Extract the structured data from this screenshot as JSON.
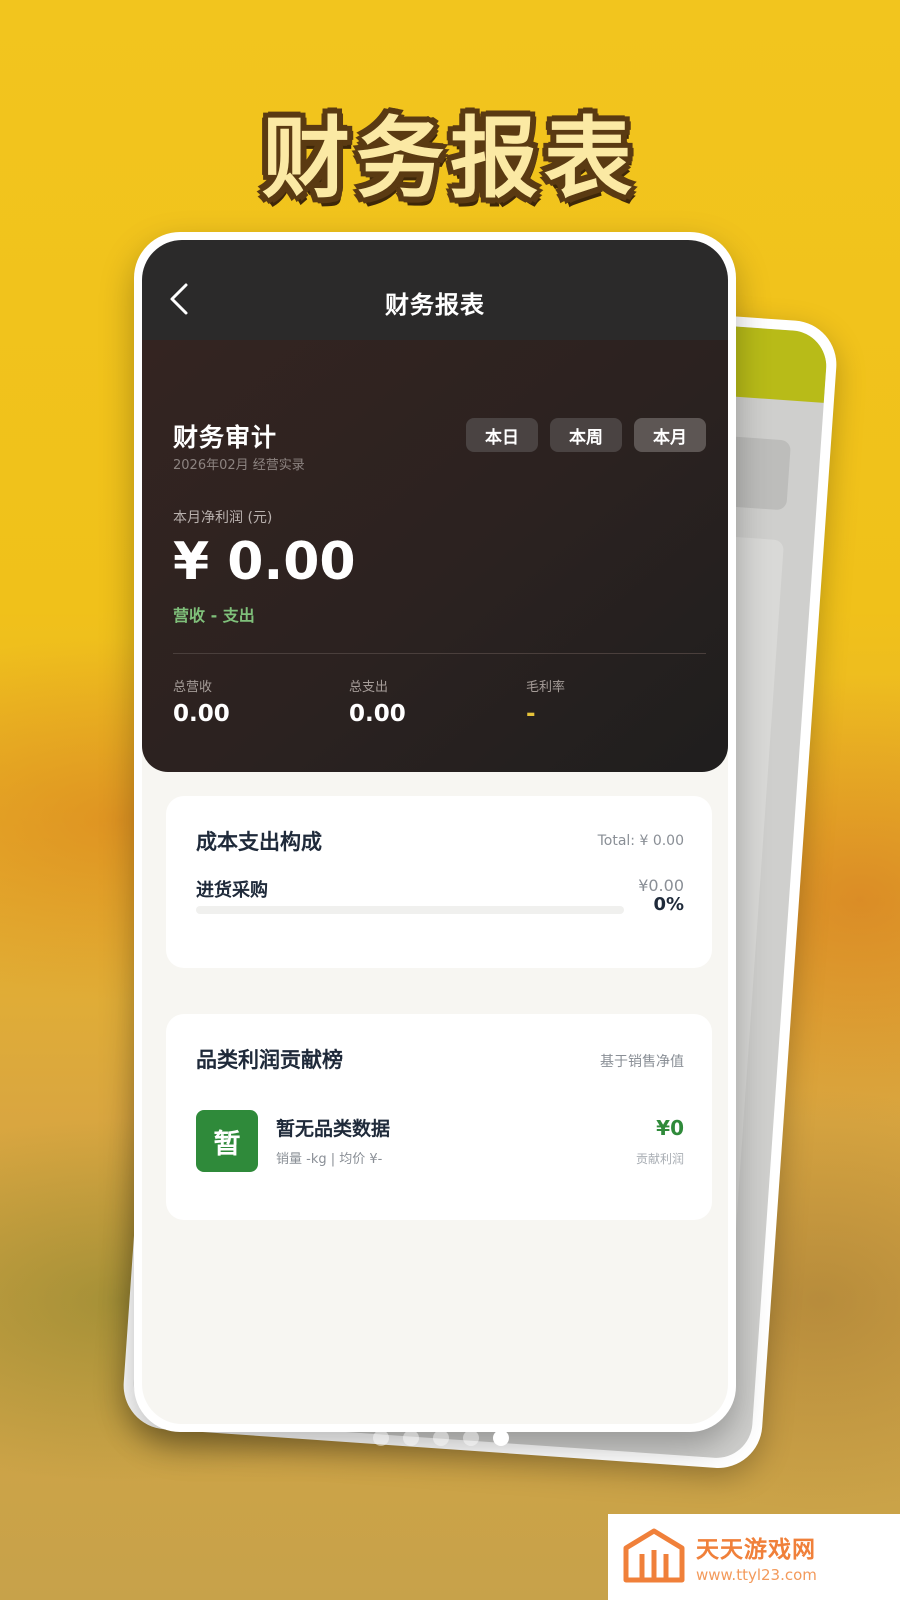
{
  "banner": {
    "title": "财务报表"
  },
  "header": {
    "title": "财务报表"
  },
  "hero": {
    "title": "财务审计",
    "subtitle": "2026年02月 经营实录",
    "period_tabs": [
      "本日",
      "本周",
      "本月"
    ],
    "active_tab": "本月",
    "net_profit_label": "本月净利润 (元)",
    "net_profit_value": "¥ 0.00",
    "formula": "营收 - 支出",
    "stats": [
      {
        "label": "总营收",
        "value": "0.00"
      },
      {
        "label": "总支出",
        "value": "0.00"
      },
      {
        "label": "毛利率",
        "value": "-"
      }
    ]
  },
  "cost_breakdown": {
    "title": "成本支出构成",
    "total": "Total: ¥ 0.00",
    "items": [
      {
        "label": "进货采购",
        "amount": "¥0.00",
        "percent": "0%",
        "ratio": 0
      }
    ]
  },
  "category_ranking": {
    "title": "品类利润贡献榜",
    "basis": "基于销售净值",
    "items": [
      {
        "avatar": "暂",
        "name": "暂无品类数据",
        "detail": "销量 -kg | 均价 ¥-",
        "profit": "¥0",
        "profit_label": "贡献利润"
      }
    ]
  },
  "carousel": {
    "count": 5,
    "active_index": 4
  },
  "watermark": {
    "name": "天天游戏网",
    "url": "www.ttyl23.com"
  },
  "colors": {
    "accent_green": "#2f8a3a",
    "formula_green": "#7fc07a",
    "hero_bg": "#2b2220",
    "banner_text": "#fbe9a4"
  },
  "icons": {
    "back": "chevron-left-icon",
    "logo": "house-logo-icon"
  }
}
